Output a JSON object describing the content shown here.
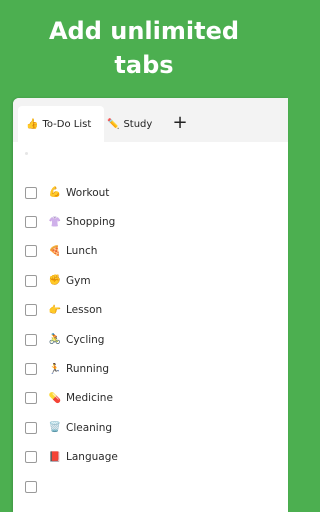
{
  "promo": {
    "line1": "Add unlimited",
    "line2": "tabs"
  },
  "tabs": [
    {
      "emoji": "👍",
      "label": "To-Do List",
      "active": true
    },
    {
      "emoji": "✏️",
      "label": "Study",
      "active": false
    }
  ],
  "add_tab_label": "+",
  "items": [
    {
      "emoji": "💪",
      "label": "Workout"
    },
    {
      "emoji": "👚",
      "label": "Shopping"
    },
    {
      "emoji": "🍕",
      "label": "Lunch"
    },
    {
      "emoji": "✊",
      "label": "Gym"
    },
    {
      "emoji": "👉",
      "label": "Lesson"
    },
    {
      "emoji": "🚴",
      "label": "Cycling"
    },
    {
      "emoji": "🏃",
      "label": "Running"
    },
    {
      "emoji": "💊",
      "label": "Medicine"
    },
    {
      "emoji": "🗑️",
      "label": "Cleaning"
    },
    {
      "emoji": "📕",
      "label": "Language"
    },
    {
      "emoji": "",
      "label": ""
    }
  ],
  "colors": {
    "background": "#4caf50",
    "sheet": "#ffffff",
    "tabbar": "#f3f3f3"
  }
}
